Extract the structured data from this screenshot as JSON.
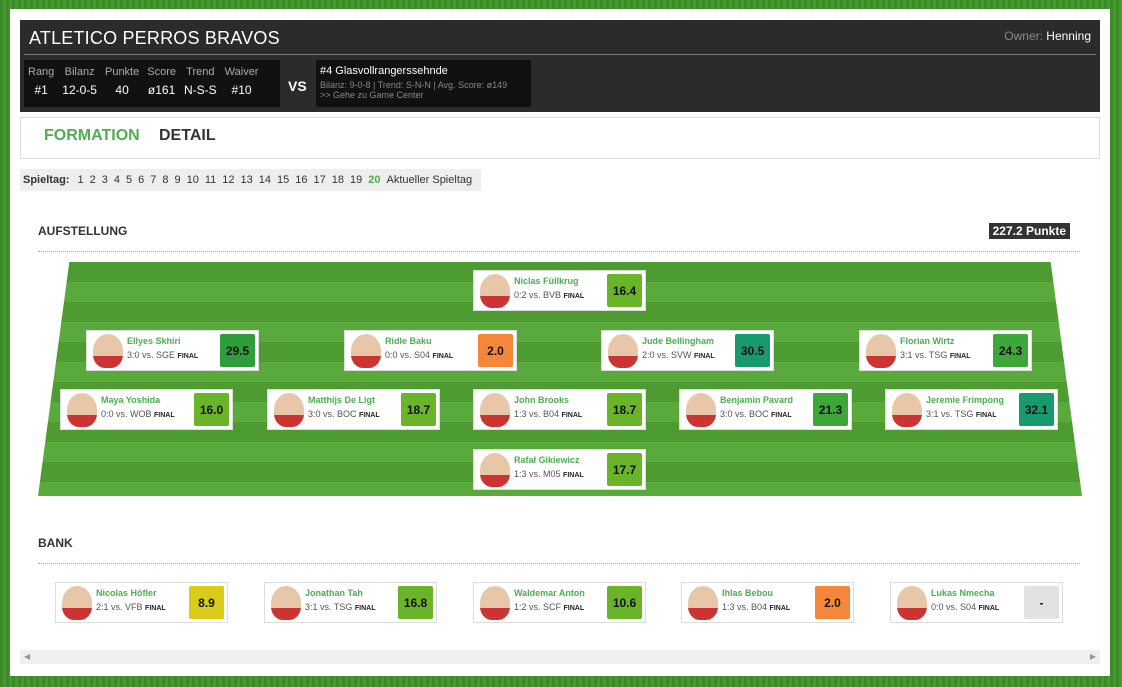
{
  "header": {
    "team": "ATLETICO PERROS BRAVOS",
    "owner_label": "Owner:",
    "owner": "Henning",
    "stats": [
      {
        "label": "Rang",
        "value": "#1"
      },
      {
        "label": "Bilanz",
        "value": "12-0-5"
      },
      {
        "label": "Punkte",
        "value": "40"
      },
      {
        "label": "Score",
        "value": "ø161"
      },
      {
        "label": "Trend",
        "value": "N-S-S"
      },
      {
        "label": "Waiver",
        "value": "#10"
      }
    ],
    "vs": "VS",
    "opponent": {
      "name": "#4 Glasvollrangerssehnde",
      "sub": "Bilanz: 9-0-8 | Trend: S-N-N | Avg. Score: ø149",
      "link": ">> Gehe zu Game Center"
    }
  },
  "tabs": [
    "FORMATION",
    "DETAIL"
  ],
  "matchdays": {
    "label": "Spieltag:",
    "days": [
      "1",
      "2",
      "3",
      "4",
      "5",
      "6",
      "7",
      "8",
      "9",
      "10",
      "11",
      "12",
      "13",
      "14",
      "15",
      "16",
      "17",
      "18",
      "19",
      "20"
    ],
    "active": "20",
    "current": "Aktueller Spieltag"
  },
  "lineup": {
    "title": "AUFSTELLUNG",
    "points": "227.2 Punkte",
    "players": [
      {
        "name": "Niclas Füllkrug",
        "info": "0:2 vs. BVB",
        "final": "FINAL",
        "score": "16.4",
        "color": "#6ab42a"
      },
      {
        "name": "Ellyes Skhiri",
        "info": "3:0 vs. SGE",
        "final": "FINAL",
        "score": "29.5",
        "color": "#2e9d3a"
      },
      {
        "name": "Ridle Baku",
        "info": "0:0 vs. S04",
        "final": "FINAL",
        "score": "2.0",
        "color": "#f4873a"
      },
      {
        "name": "Jude Bellingham",
        "info": "2:0 vs. SVW",
        "final": "FINAL",
        "score": "30.5",
        "color": "#179a6e"
      },
      {
        "name": "Florian Wirtz",
        "info": "3:1 vs. TSG",
        "final": "FINAL",
        "score": "24.3",
        "color": "#3fa63a"
      },
      {
        "name": "Maya Yoshida",
        "info": "0:0 vs. WOB",
        "final": "FINAL",
        "score": "16.0",
        "color": "#6ab42a"
      },
      {
        "name": "Matthijs De Ligt",
        "info": "3:0 vs. BOC",
        "final": "FINAL",
        "score": "18.7",
        "color": "#6ab42a"
      },
      {
        "name": "John Brooks",
        "info": "1:3 vs. B04",
        "final": "FINAL",
        "score": "18.7",
        "color": "#6ab42a"
      },
      {
        "name": "Benjamin Pavard",
        "info": "3:0 vs. BOC",
        "final": "FINAL",
        "score": "21.3",
        "color": "#3fa63a"
      },
      {
        "name": "Jeremie Frimpong",
        "info": "3:1 vs. TSG",
        "final": "FINAL",
        "score": "32.1",
        "color": "#179a6e"
      },
      {
        "name": "Rafał Gikiewicz",
        "info": "1:3 vs. M05",
        "final": "FINAL",
        "score": "17.7",
        "color": "#6ab42a"
      }
    ]
  },
  "bench": {
    "title": "BANK",
    "players": [
      {
        "name": "Nicolas Höfler",
        "info": "2:1 vs. VFB",
        "final": "FINAL",
        "score": "8.9",
        "color": "#d8cc18"
      },
      {
        "name": "Jonathan Tah",
        "info": "3:1 vs. TSG",
        "final": "FINAL",
        "score": "16.8",
        "color": "#6ab42a"
      },
      {
        "name": "Waldemar Anton",
        "info": "1:2 vs. SCF",
        "final": "FINAL",
        "score": "10.6",
        "color": "#6ab42a"
      },
      {
        "name": "Ihlas Bebou",
        "info": "1:3 vs. B04",
        "final": "FINAL",
        "score": "2.0",
        "color": "#f4873a"
      },
      {
        "name": "Lukas Nmecha",
        "info": "0:0 vs. S04",
        "final": "FINAL",
        "score": "-",
        "color": "#e2e2e2"
      }
    ]
  }
}
